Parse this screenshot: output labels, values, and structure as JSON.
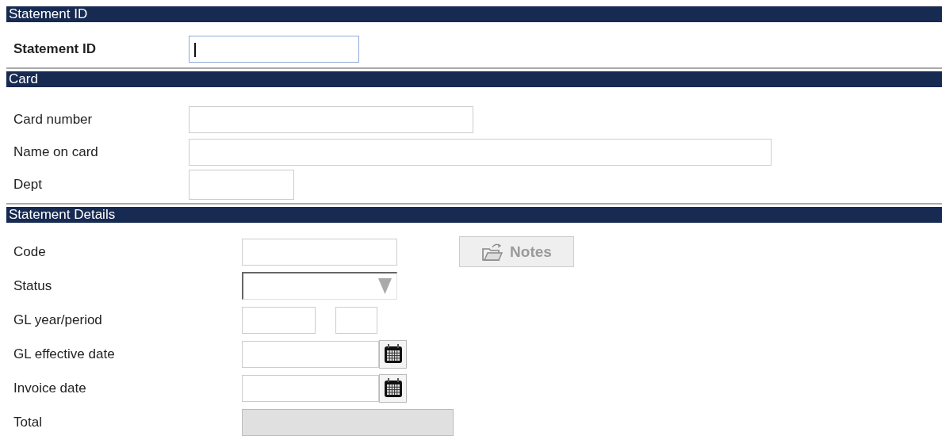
{
  "sections": [
    {
      "kind": "id",
      "title": "Statement ID",
      "fields": [
        {
          "label": "Statement ID",
          "kind": "text",
          "focused": true
        }
      ]
    },
    {
      "kind": "card",
      "title": "Card",
      "fields": [
        {
          "label": "Card number",
          "kind": "text",
          "focused": false
        },
        {
          "label": "Name on card",
          "kind": "text",
          "focused": false
        },
        {
          "label": "Dept",
          "kind": "text",
          "focused": false
        }
      ]
    },
    {
      "kind": "details",
      "title": "Statement Details",
      "fields": [
        {
          "label": "Code",
          "kind": "text",
          "focused": false,
          "button": {
            "label": "Notes",
            "disabled": true
          }
        },
        {
          "label": "Status",
          "kind": "select"
        },
        {
          "label": "GL year/period",
          "kind": "period"
        },
        {
          "label": "GL effective date",
          "kind": "date"
        },
        {
          "label": "Invoice date",
          "kind": "date"
        },
        {
          "label": "Total",
          "kind": "readonly"
        }
      ]
    }
  ]
}
